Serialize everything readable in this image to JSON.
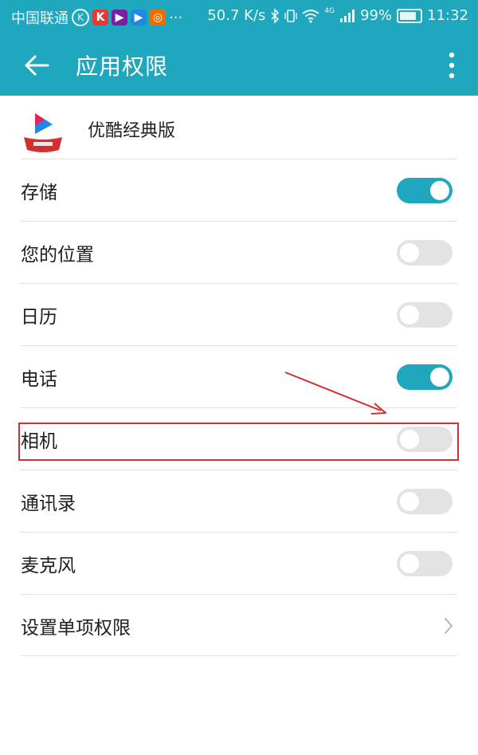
{
  "status_bar": {
    "carrier": "中国联通",
    "speed": "50.7 K/s",
    "network_badge": "4G",
    "battery": "99%",
    "time": "11:32",
    "more_dots": "···"
  },
  "app_bar": {
    "title": "应用权限"
  },
  "app_info": {
    "name": "优酷经典版"
  },
  "permissions": [
    {
      "label": "存储",
      "enabled": true
    },
    {
      "label": "您的位置",
      "enabled": false
    },
    {
      "label": "日历",
      "enabled": false
    },
    {
      "label": "电话",
      "enabled": true
    },
    {
      "label": "相机",
      "enabled": false
    },
    {
      "label": "通讯录",
      "enabled": false
    },
    {
      "label": "麦克风",
      "enabled": false
    }
  ],
  "individual_permissions": {
    "label": "设置单项权限"
  },
  "colors": {
    "accent": "#1fa7bd",
    "toggle_off": "#e3e3e3",
    "annotation": "#d32f2f"
  },
  "icons": {
    "back": "arrow-left-icon",
    "more": "more-vertical-icon",
    "chevron": "chevron-right-icon",
    "wifi": "wifi-icon",
    "signal": "signal-icon",
    "bluetooth": "bluetooth-icon",
    "battery": "battery-icon"
  }
}
